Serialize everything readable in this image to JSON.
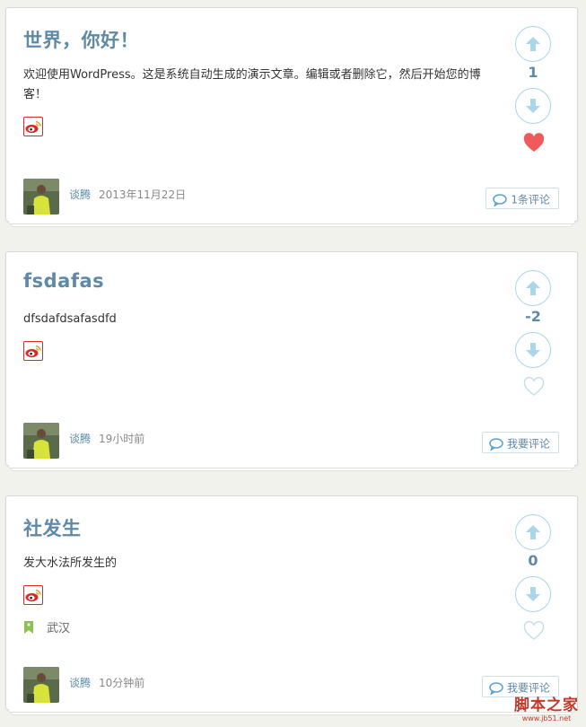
{
  "posts": [
    {
      "title": "世界，你好！",
      "excerpt": "欢迎使用WordPress。这是系统自动生成的演示文章。编辑或者删除它，然后开始您的博客！",
      "author": "谈腾",
      "time": "2013年11月22日",
      "comment_label": "1条评论",
      "score": "1",
      "liked": true,
      "location": ""
    },
    {
      "title": "fsdafas",
      "excerpt": "dfsdafdsafasdfd",
      "author": "谈腾",
      "time": "19小时前",
      "comment_label": "我要评论",
      "score": "-2",
      "liked": false,
      "location": ""
    },
    {
      "title": "社发生",
      "excerpt": "发大水法所发生的",
      "author": "谈腾",
      "time": "10分钟前",
      "comment_label": "我要评论",
      "score": "0",
      "liked": false,
      "location": "武汉"
    }
  ],
  "icons": {
    "weibo": "weibo-icon",
    "vote_up": "arrow-up-icon",
    "vote_down": "arrow-down-icon",
    "heart": "heart-icon",
    "comment": "comment-bubble-icon",
    "location": "bookmark-pin-icon"
  },
  "colors": {
    "accent": "#5e8aa8",
    "vote_ring": "#a9d6e8",
    "heart_active": "#f05a5a",
    "heart_inactive": "#bfe0ec",
    "location_pin": "#8cc152"
  },
  "watermark": {
    "main": "脚本之家",
    "sub": "www.jb51.net"
  }
}
